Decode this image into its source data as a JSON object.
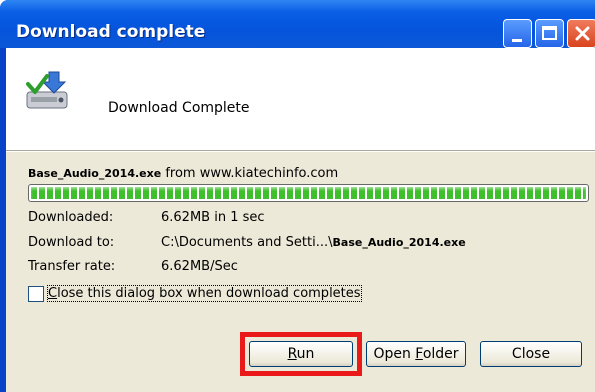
{
  "window": {
    "title": "Download complete"
  },
  "header": {
    "icon": "download-complete-icon",
    "message": "Download Complete"
  },
  "source": {
    "filename": "Base_Audio_2014.exe",
    "from_text": "from www.kiatechinfo.com"
  },
  "progress": {
    "percent": 100,
    "color": "#3fbf2e"
  },
  "info": {
    "downloaded_label": "Downloaded:",
    "downloaded_value": "6.62MB in 1 sec",
    "download_to_label": "Download to:",
    "download_to_path": "C:\\Documents and Setti...\\",
    "download_to_file": "Base_Audio_2014.exe",
    "transfer_rate_label": "Transfer rate:",
    "transfer_rate_value": "6.62MB/Sec"
  },
  "option": {
    "close_when_complete_label_access": "C",
    "close_when_complete_label_rest": "lose this dialog box when download completes",
    "checked": false
  },
  "buttons": {
    "run_access": "R",
    "run_rest": "un",
    "open_folder_pre": "Open ",
    "open_folder_access": "F",
    "open_folder_rest": "older",
    "close": "Close"
  },
  "highlight_color": "#ea1a1a"
}
